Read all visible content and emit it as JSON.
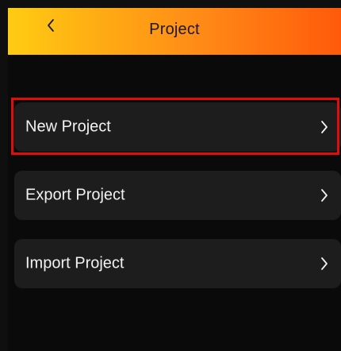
{
  "header": {
    "title": "Project",
    "back_icon": "chevron-left-icon"
  },
  "items": [
    {
      "label": "New Project",
      "icon": "chevron-right-icon",
      "highlighted": true
    },
    {
      "label": "Export Project",
      "icon": "chevron-right-icon"
    },
    {
      "label": "Import Project",
      "icon": "chevron-right-icon"
    }
  ],
  "colors": {
    "header_gradient_start": "#ffcc12",
    "header_gradient_end": "#ff5a0a",
    "background": "#0a0a0a",
    "card": "#1d1d1d",
    "highlight": "#e10d0d",
    "text": "#f2f2f2"
  }
}
